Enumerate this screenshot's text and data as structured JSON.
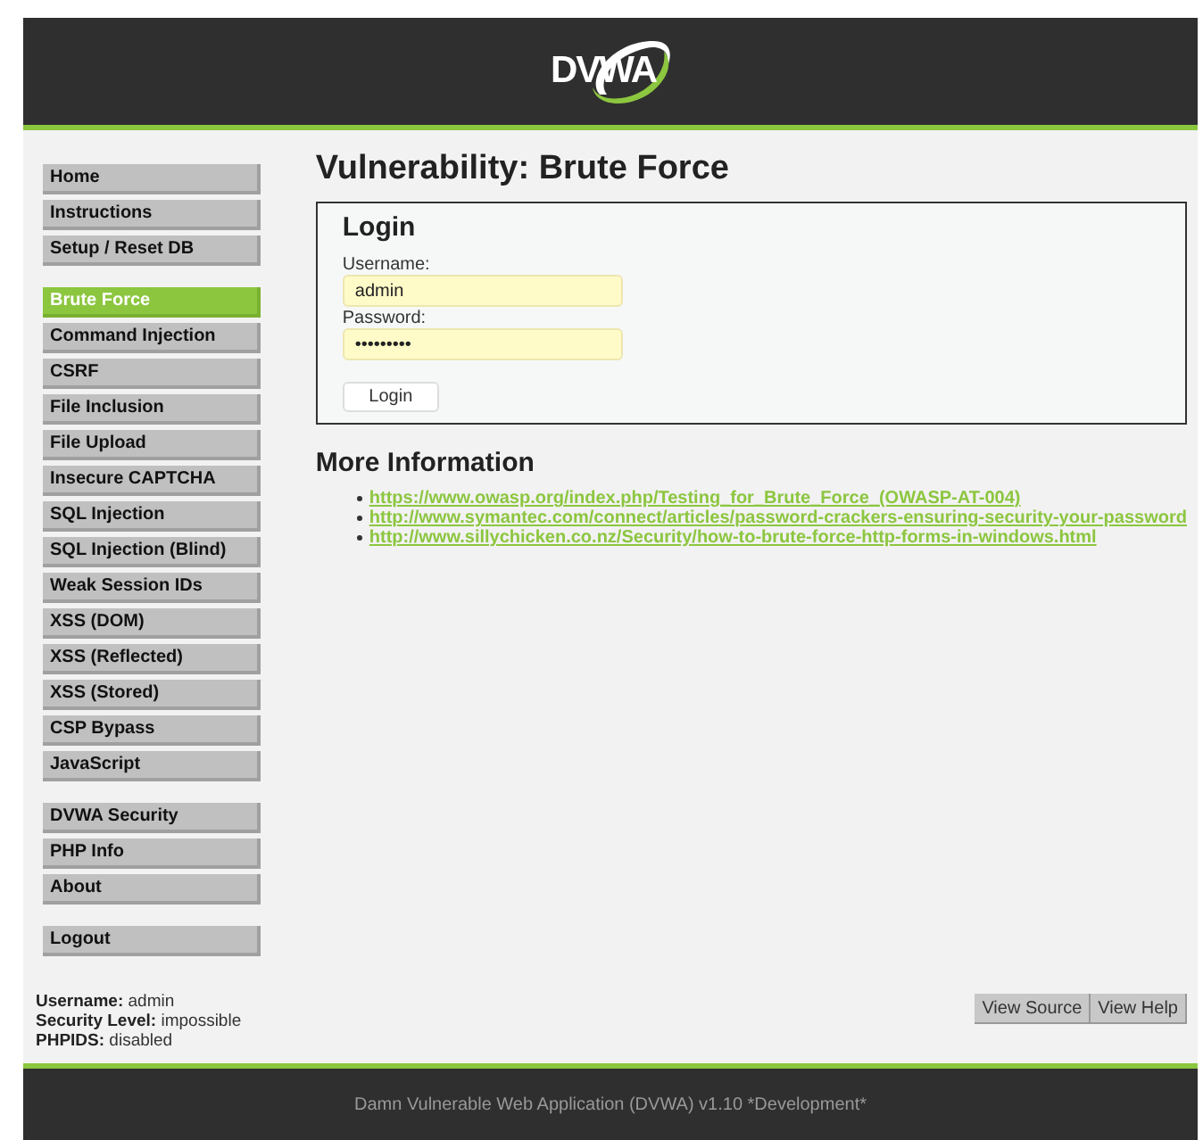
{
  "header": {
    "logo": "DVWA"
  },
  "menu": [
    [
      {
        "label": "Home",
        "selected": false
      },
      {
        "label": "Instructions",
        "selected": false
      },
      {
        "label": "Setup / Reset DB",
        "selected": false
      }
    ],
    [
      {
        "label": "Brute Force",
        "selected": true
      },
      {
        "label": "Command Injection",
        "selected": false
      },
      {
        "label": "CSRF",
        "selected": false
      },
      {
        "label": "File Inclusion",
        "selected": false
      },
      {
        "label": "File Upload",
        "selected": false
      },
      {
        "label": "Insecure CAPTCHA",
        "selected": false
      },
      {
        "label": "SQL Injection",
        "selected": false
      },
      {
        "label": "SQL Injection (Blind)",
        "selected": false
      },
      {
        "label": "Weak Session IDs",
        "selected": false
      },
      {
        "label": "XSS (DOM)",
        "selected": false
      },
      {
        "label": "XSS (Reflected)",
        "selected": false
      },
      {
        "label": "XSS (Stored)",
        "selected": false
      },
      {
        "label": "CSP Bypass",
        "selected": false
      },
      {
        "label": "JavaScript",
        "selected": false
      }
    ],
    [
      {
        "label": "DVWA Security",
        "selected": false
      },
      {
        "label": "PHP Info",
        "selected": false
      },
      {
        "label": "About",
        "selected": false
      }
    ],
    [
      {
        "label": "Logout",
        "selected": false
      }
    ]
  ],
  "page_title": "Vulnerability: Brute Force",
  "login_form": {
    "title": "Login",
    "fields": [
      {
        "label": "Username:",
        "value": "admin"
      },
      {
        "label": "Password:",
        "value": "•••••••••"
      }
    ],
    "button": "Login"
  },
  "more_info": {
    "title": "More Information",
    "links": [
      "https://www.owasp.org/index.php/Testing_for_Brute_Force_(OWASP-AT-004)",
      "http://www.symantec.com/connect/articles/password-crackers-ensuring-security-your-password",
      "http://www.sillychicken.co.nz/Security/how-to-brute-force-http-forms-in-windows.html"
    ]
  },
  "session_info": [
    {
      "label": "Username:",
      "value": "admin"
    },
    {
      "label": "Security Level:",
      "value": "impossible"
    },
    {
      "label": "PHPIDS:",
      "value": "disabled"
    }
  ],
  "buttons": [
    "View Source",
    "View Help"
  ],
  "footer": "Damn Vulnerable Web Application (DVWA) v1.10 *Development*"
}
